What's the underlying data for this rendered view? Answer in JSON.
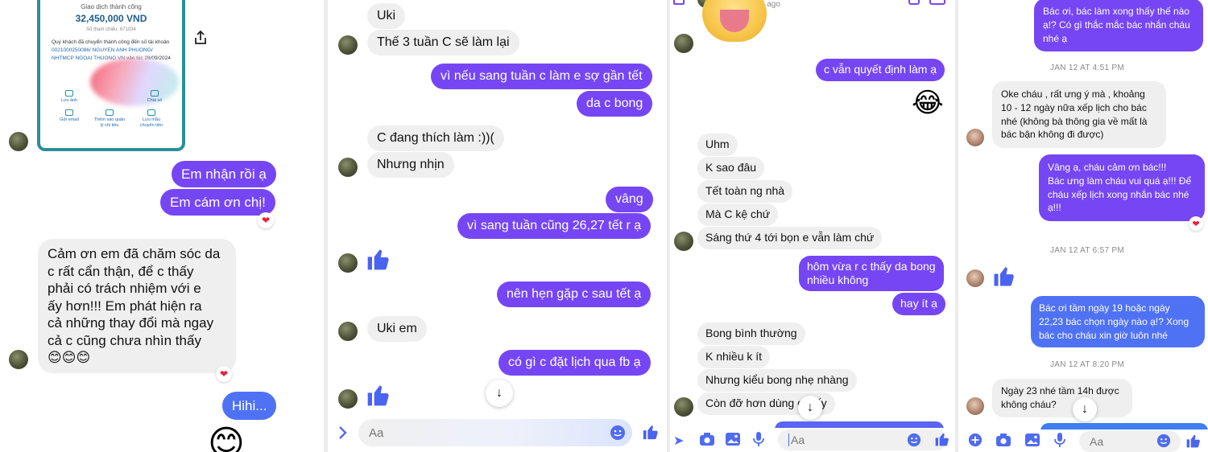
{
  "panel1": {
    "receipt": {
      "title": "Giao dịch thành công",
      "amount": "32,450,000 VND",
      "ref": "Số tham chiếu: 671034",
      "desc_pre": "Quý khách đã chuyển thành công đến số tài khoản ",
      "desc_acct": "0021000250086/ NGUYEN ANH PHUONG/ NHTMCP NGOAI THUONG VN",
      "desc_post": " vào lúc 28/09/2024",
      "actions": [
        "Lưu ảnh",
        "Chia sẻ",
        "Gửi email",
        "Thêm vào quản lý chi tiêu",
        "Lưu mẫu chuyển tiền"
      ]
    },
    "messages": {
      "m1": "Em nhận rồi ạ",
      "m2": "Em cám ơn chị!",
      "m3_lines": [
        "Cảm ơn em đã chăm sóc da",
        "c rất cẩn thận, để c thấy",
        "phải có trách nhiệm với e",
        "ấy hơn!!! Em phát hiện ra",
        "cả những thay đổi mà ngay",
        "cả c cũng chưa nhìn thấy"
      ],
      "m3_emoji": "😊😊😊",
      "m4": "Hihi...",
      "big_emoji": "😊"
    },
    "share_icon": "share-icon"
  },
  "panel2": {
    "m1": "Uki",
    "m2": "Thế 3 tuần C sẽ làm lại",
    "m3": "vì nếu sang tuần c làm e sợ gần tết",
    "m4": "da c bong",
    "m5": "C đang thích làm :))(",
    "m6": "Nhưng nhịn",
    "m7": "vâng",
    "m8": "vì sang tuần cũng 26,27 tết r ạ",
    "m9": "nên hẹn gặp c sau tết ạ",
    "m10": "Uki em",
    "m11": "có gì c đặt lịch qua fb ạ",
    "composer_placeholder": "Aa"
  },
  "panel3": {
    "active_status": "Active 36m ago",
    "m1": "c vẫn quyết định làm ạ",
    "emoji1": "😂",
    "m2": "Uhm",
    "m3": "K sao đâu",
    "m4": "Tết toàn ng nhà",
    "m5": "Mà C kệ chứ",
    "m6": "Sáng thứ 4 tới bọn e vẫn làm chứ",
    "m7_lines": [
      "hôm vừa r c thấy da bong",
      "nhiều không"
    ],
    "m8": "hay ít ạ",
    "m9": "Bong bình thường",
    "m10": "K nhiều k ít",
    "m11": "Nhưng kiểu bong nhẹ nhàng",
    "m12": "Còn đỡ hơn dùng cái ấy",
    "composer_placeholder": "Aa"
  },
  "panel4": {
    "m1_lines": [
      "Bác ơi, bác làm xong thấy thế nào",
      "ạ!? Có gì thắc mắc bác nhắn cháu",
      "nhé ạ"
    ],
    "ts1": "JAN 12 AT 4:51 PM",
    "m2_lines": [
      "Oke cháu , rất ưng ý mà , khoảng",
      "10 - 12 ngày nữa xếp lịch cho bác",
      "nhé (không bà thông gia về mất là",
      "bác bận không đi được)"
    ],
    "m3_lines": [
      "Vâng ạ, cháu cảm ơn bác!!!",
      "Bác ưng làm cháu vui quá ạ!!! Để",
      "cháu xếp lịch xong nhắn bác nhé",
      "ạ!!!"
    ],
    "ts2": "JAN 12 AT 6:57 PM",
    "m4_lines": [
      "Bác ơi tầm ngày 19 hoặc ngày",
      "22,23 bác chọn ngày nào ạ!? Xong",
      "bác cho cháu xin giờ luôn nhé"
    ],
    "ts3": "JAN 12 AT 8:20 PM",
    "m5_lines": [
      "Ngày 23 nhé tầm 14h được",
      "không cháu?"
    ],
    "composer_placeholder": "Aa"
  },
  "colors": {
    "outgoing_purple": "#7646f4",
    "outgoing_blue": "#4f72f5",
    "incoming_gray": "#efefef",
    "like_blue": "#4a63f0",
    "heart_red": "#e8203a",
    "receipt_teal": "#2a8f9a"
  }
}
